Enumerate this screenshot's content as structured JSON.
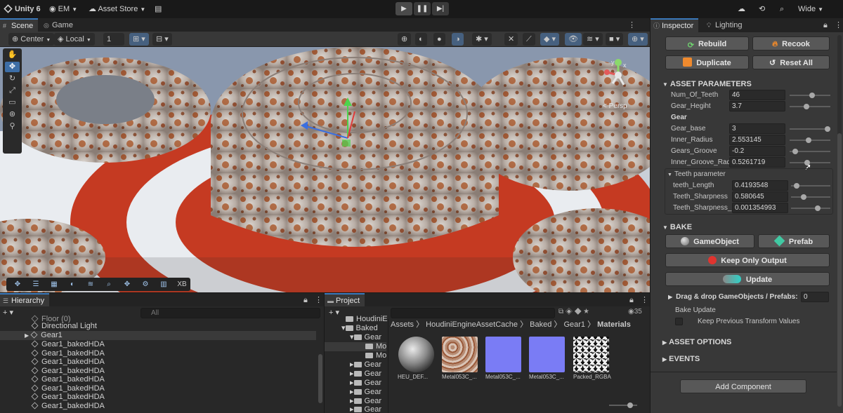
{
  "toolbar": {
    "app_title": "Unity 6",
    "account": "EM",
    "asset_store": "Asset Store",
    "layout": "Wide"
  },
  "scene_tabs": {
    "scene": "Scene",
    "game": "Game"
  },
  "scene_toolbar": {
    "pivot": "Center",
    "space": "Local",
    "snap_value": "1"
  },
  "viewport": {
    "persp_label": "< Persp",
    "gizmo_y": "y",
    "gizmo_x": "x"
  },
  "overlay": {
    "xb_label": "XB"
  },
  "hierarchy": {
    "title": "Hierarchy",
    "search_placeholder": "All",
    "items": [
      "Floor (0)",
      "Directional Light",
      "Gear1",
      "Gear1_bakedHDA",
      "Gear1_bakedHDA",
      "Gear1_bakedHDA",
      "Gear1_bakedHDA",
      "Gear1_bakedHDA",
      "Gear1_bakedHDA",
      "Gear1_bakedHDA",
      "Gear1_bakedHDA"
    ]
  },
  "project": {
    "title": "Project",
    "count": "35",
    "tree": [
      "HoudiniE",
      "Baked",
      "Gear",
      "Mo",
      "Mo",
      "Gear",
      "Gear",
      "Gear",
      "Gear",
      "Gear",
      "Gear"
    ],
    "breadcrumb": [
      "Assets",
      "HoudiniEngineAssetCache",
      "Baked",
      "Gear1",
      "Materials"
    ],
    "assets": [
      "HEU_DEF...",
      "Metal053C_...",
      "Metal053C_...",
      "Metal053C_...",
      "Packed_RGBA"
    ]
  },
  "inspector": {
    "tab_inspector": "Inspector",
    "tab_lighting": "Lighting",
    "rebuild": "Rebuild",
    "recook": "Recook",
    "duplicate": "Duplicate",
    "reset_all": "Reset All",
    "asset_parameters": "ASSET PARAMETERS",
    "params": [
      {
        "label": "Num_Of_Teeth",
        "value": "46",
        "slider": 0.56
      },
      {
        "label": "Gear_Hegiht",
        "value": "3.7",
        "slider": 0.4
      },
      {
        "label": "Gear_base",
        "value": "3",
        "slider": 1.0
      },
      {
        "label": "Inner_Radius",
        "value": "2.553145",
        "slider": 0.45
      },
      {
        "label": "Gears_Groove",
        "value": "-0.2",
        "slider": 0.07
      },
      {
        "label": "Inner_Groove_Radius",
        "value": "0.5261719",
        "slider": 0.42
      }
    ],
    "gear_group": "Gear",
    "teeth_group": "Teeth parameter",
    "teeth_params": [
      {
        "label": "teeth_Length",
        "value": "0.4193548",
        "slider": 0.09
      },
      {
        "label": "Teeth_Sharpness",
        "value": "0.580645",
        "slider": 0.3
      },
      {
        "label": "Teeth_Sharpness_l",
        "value": "0.001354993",
        "slider": 0.7
      }
    ],
    "bake": "BAKE",
    "gameobject": "GameObject",
    "prefab": "Prefab",
    "keep_only_output": "Keep Only Output",
    "update": "Update",
    "drag_drop": "Drag & drop GameObjects / Prefabs:",
    "drag_count": "0",
    "bake_update": "Bake Update",
    "keep_previous": "Keep Previous Transform Values",
    "asset_options": "ASSET OPTIONS",
    "events": "EVENTS",
    "add_component": "Add Component"
  },
  "colors": {
    "accent_blue": "#3a79bb",
    "floor_red": "#c53a22",
    "gizmo_green": "#4dd34d",
    "gizmo_red": "#e03b3b",
    "gizmo_blue": "#3b6fe0"
  }
}
